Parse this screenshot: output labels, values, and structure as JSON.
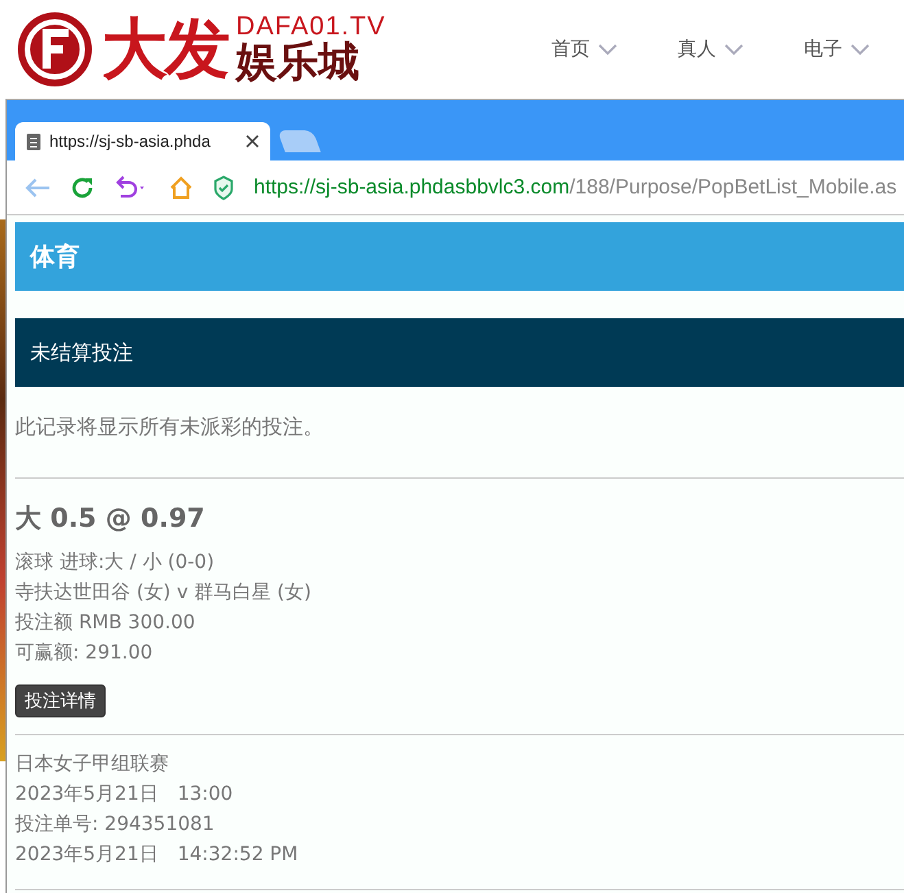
{
  "site_header": {
    "logo_big": "大发",
    "logo_domain": "DAFA01.TV",
    "logo_sub": "娱乐城",
    "nav": [
      {
        "label": "首页"
      },
      {
        "label": "真人"
      },
      {
        "label": "电子"
      }
    ]
  },
  "browser": {
    "tabs": [
      {
        "title": "https://sj-sb-asia.phda",
        "selected": true
      },
      {
        "selected": false
      }
    ],
    "address": {
      "host": "https://sj-sb-asia.phdasbbvlc3.com",
      "path": "/188/Purpose/PopBetList_Mobile.as"
    }
  },
  "page": {
    "section_title": "体育",
    "subsection_title": "未结算投注",
    "description": "此记录将显示所有未派彩的投注。",
    "bets": [
      {
        "title": "大 0.5 @ 0.97",
        "market": "滚球 进球:大 / 小 (0-0)",
        "match": "寺扶达世田谷 (女) v 群马白星 (女)",
        "stake": "投注额 RMB 300.00",
        "to_win": "可赢额: 291.00",
        "details_button": "投注详情",
        "league": "日本女子甲组联赛",
        "match_time": "2023年5月21日　13:00",
        "bet_id": "投注单号: 294351081",
        "placed_time": "2023年5月21日　14:32:52 PM"
      }
    ]
  }
}
